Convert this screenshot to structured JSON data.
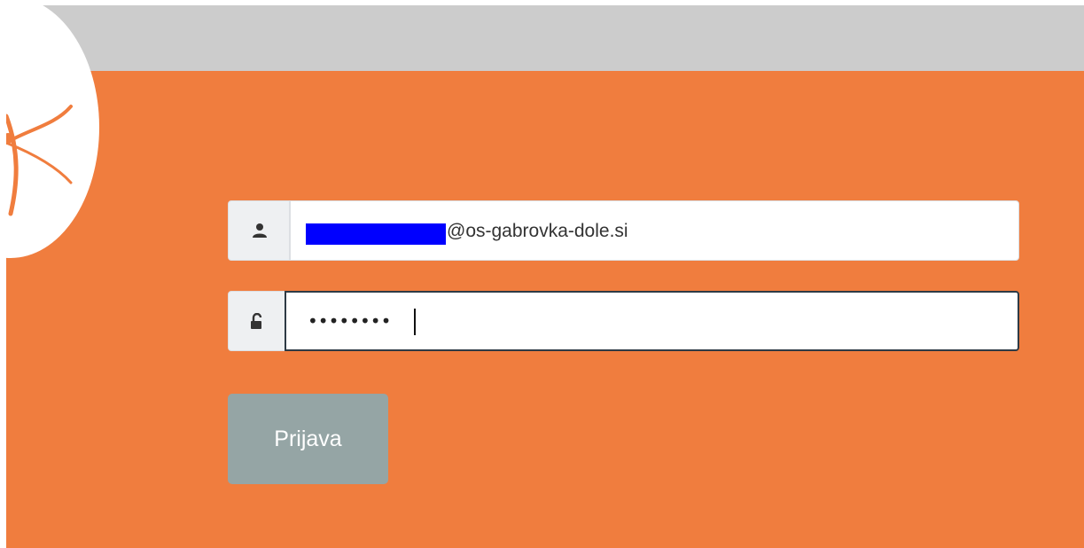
{
  "login_form": {
    "email": {
      "icon": "user-icon",
      "value_suffix": "@os-gabrovka-dole.si",
      "redaction_color": "#0000ff"
    },
    "password": {
      "icon": "unlock-icon",
      "masked_value": "••••••••"
    },
    "submit_label": "Prijava"
  },
  "colors": {
    "top_bar": "#cccccc",
    "panel": "#f07d3e",
    "button": "#95a5a5",
    "logo_mark": "#f07d3e"
  }
}
